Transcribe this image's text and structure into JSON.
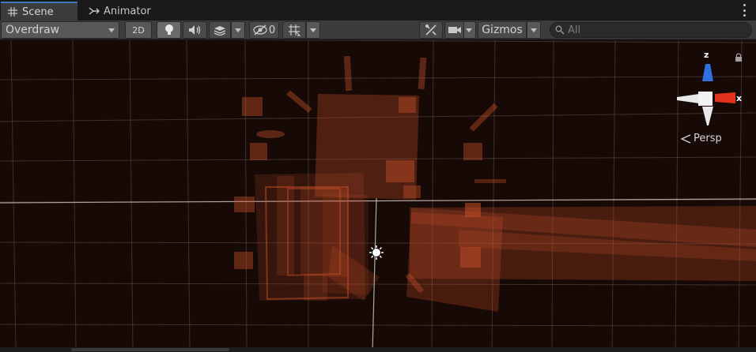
{
  "tabs": [
    {
      "label": "Scene",
      "icon": "grid-icon",
      "active": true
    },
    {
      "label": "Animator",
      "icon": "animator-icon",
      "active": false
    }
  ],
  "toolbar": {
    "draw_mode": "Overdraw",
    "mode_2d": "2D",
    "hidden_count": "0",
    "gizmos": "Gizmos",
    "search_placeholder": "All"
  },
  "viewport": {
    "projection": "Persp",
    "axes": {
      "x": "x",
      "z": "z"
    },
    "colors": {
      "background": "#170a06",
      "overdraw": "#c8502a",
      "grid": "#8a7670",
      "x_axis": "#e0321e",
      "z_axis": "#2f6fe0"
    }
  }
}
